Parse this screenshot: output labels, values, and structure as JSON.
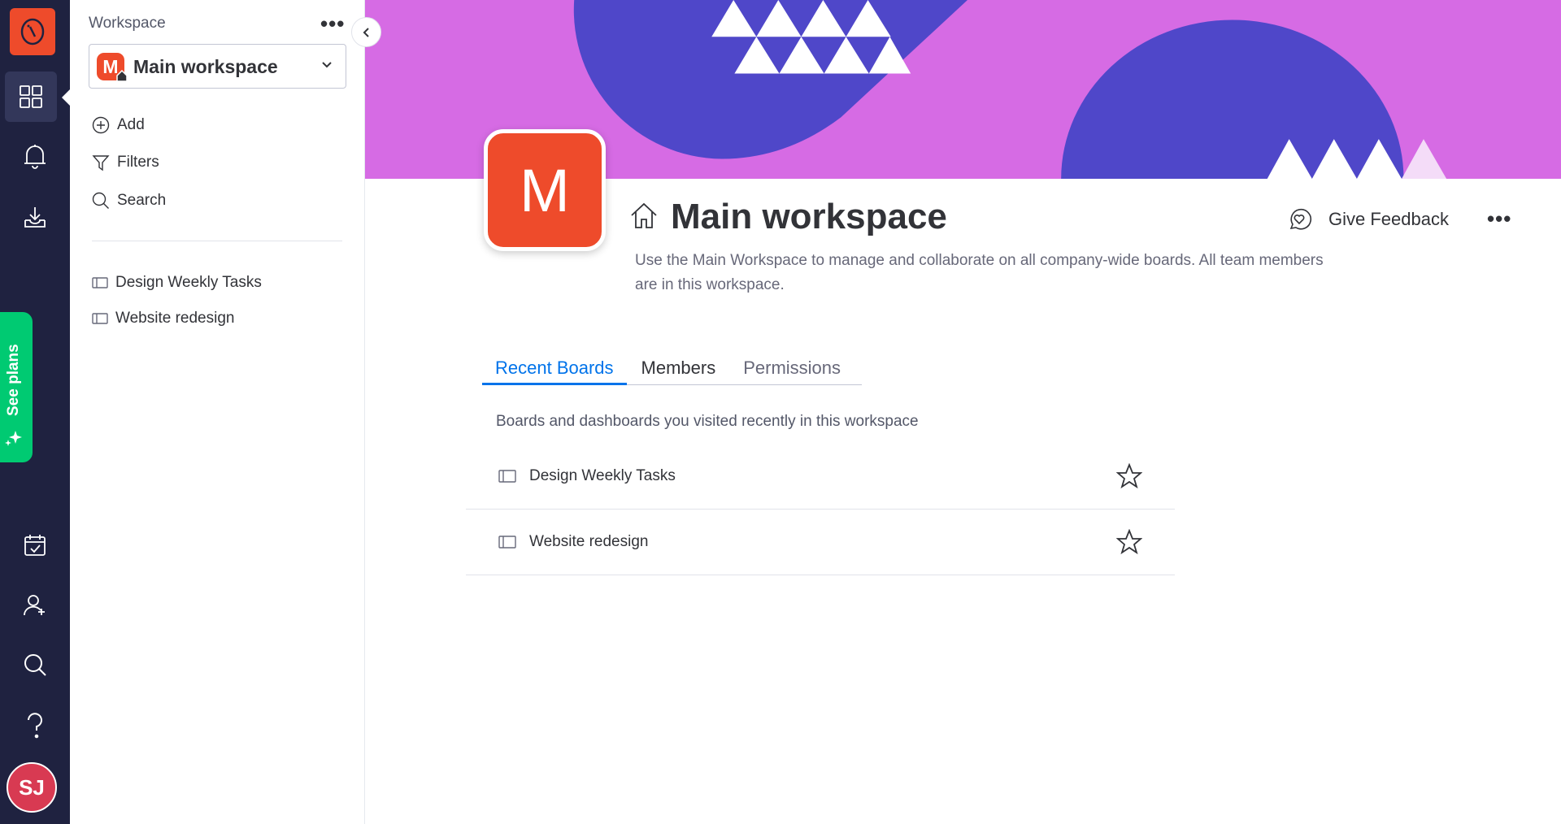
{
  "nav": {
    "icons": [
      "monday-logo-icon",
      "workspaces-grid-icon",
      "bell-icon",
      "inbox-download-icon",
      "my-work-calendar-icon",
      "invite-user-icon",
      "search-icon",
      "help-icon"
    ],
    "see_plans": "See plans",
    "avatar_initials": "SJ"
  },
  "sidebar": {
    "label": "Workspace",
    "workspace_badge": "M",
    "workspace_name": "Main workspace",
    "actions": {
      "add": "Add",
      "filters": "Filters",
      "search": "Search"
    },
    "boards": [
      "Design Weekly Tasks",
      "Website redesign"
    ]
  },
  "header": {
    "logo_letter": "M",
    "title": "Main workspace",
    "description": "Use the Main Workspace to manage and collaborate on all company-wide boards. All team members are in this workspace.",
    "feedback": "Give Feedback"
  },
  "tabs": [
    "Recent Boards",
    "Members",
    "Permissions"
  ],
  "recent": {
    "subtitle": "Boards and dashboards you visited recently in this workspace",
    "boards": [
      "Design Weekly Tasks",
      "Website redesign"
    ]
  },
  "colors": {
    "accent": "#0073ea",
    "brand": "#ee4b2b",
    "banner_pink": "#d66be4",
    "banner_indigo": "#4f47c9",
    "nav_bg": "#1f2240",
    "plans_green": "#00ca72"
  }
}
